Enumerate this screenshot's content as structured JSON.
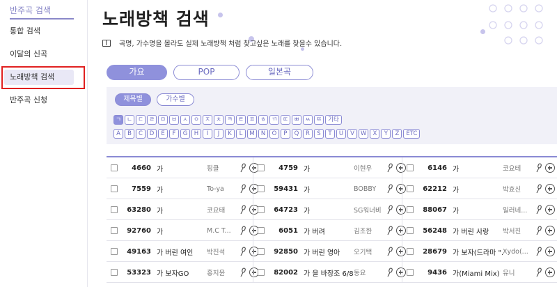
{
  "sidebar": {
    "title": "반주곡 검색",
    "items": [
      {
        "label": "통합 검색"
      },
      {
        "label": "이달의 신곡"
      },
      {
        "label": "노래방책 검색"
      },
      {
        "label": "반주곡 신청"
      }
    ]
  },
  "page": {
    "title": "노래방책 검색",
    "description": "곡명, 가수명을 몰라도 실제 노래방책 처럼 찾고싶은 노래를 찾을수 있습니다."
  },
  "tabs": [
    "가요",
    "POP",
    "일본곡"
  ],
  "subtabs": [
    "제목별",
    "가수별"
  ],
  "hangul_keys": [
    "ㄱ",
    "ㄴ",
    "ㄷ",
    "ㄹ",
    "ㅁ",
    "ㅂ",
    "ㅅ",
    "ㅇ",
    "ㅈ",
    "ㅊ",
    "ㅋ",
    "ㅌ",
    "ㅍ",
    "ㅎ",
    "ㄲ",
    "ㄸ",
    "ㅃ",
    "ㅆ",
    "ㅉ",
    "기타"
  ],
  "alpha_keys": [
    "A",
    "B",
    "C",
    "D",
    "E",
    "F",
    "G",
    "H",
    "I",
    "J",
    "K",
    "L",
    "M",
    "N",
    "O",
    "P",
    "Q",
    "R",
    "S",
    "T",
    "U",
    "V",
    "W",
    "X",
    "Y",
    "Z",
    "ETC"
  ],
  "results": [
    [
      {
        "num": "4660",
        "title": "가",
        "artist": "핑클"
      },
      {
        "num": "4759",
        "title": "가",
        "artist": "이현우"
      },
      {
        "num": "6146",
        "title": "가",
        "artist": "코요테"
      }
    ],
    [
      {
        "num": "7559",
        "title": "가",
        "artist": "To-ya"
      },
      {
        "num": "59431",
        "title": "가",
        "artist": "BOBBY"
      },
      {
        "num": "62212",
        "title": "가",
        "artist": "박효신"
      }
    ],
    [
      {
        "num": "63280",
        "title": "가",
        "artist": "코요태"
      },
      {
        "num": "64723",
        "title": "가",
        "artist": "SG워너비"
      },
      {
        "num": "88067",
        "title": "가",
        "artist": "일러네..."
      }
    ],
    [
      {
        "num": "92760",
        "title": "가",
        "artist": "M.C T..."
      },
      {
        "num": "6051",
        "title": "가 버려",
        "artist": "김조한"
      },
      {
        "num": "56248",
        "title": "가 버린 사랑",
        "artist": "박서진"
      }
    ],
    [
      {
        "num": "49163",
        "title": "가 버린 여인",
        "artist": "박진석"
      },
      {
        "num": "92850",
        "title": "가 버린 영아",
        "artist": "오기택"
      },
      {
        "num": "28679",
        "title": "가 보자(드라마 \"...",
        "artist": "Xydo(..."
      }
    ],
    [
      {
        "num": "53323",
        "title": "가 보자GO",
        "artist": "홍지윤"
      },
      {
        "num": "82002",
        "title": "가 을 바장조 6/8",
        "artist": "동요"
      },
      {
        "num": "9436",
        "title": "가(Miami Mix)",
        "artist": "유니"
      }
    ]
  ],
  "colors": {
    "accent": "#8f91dc",
    "highlight_box": "#e02020"
  }
}
